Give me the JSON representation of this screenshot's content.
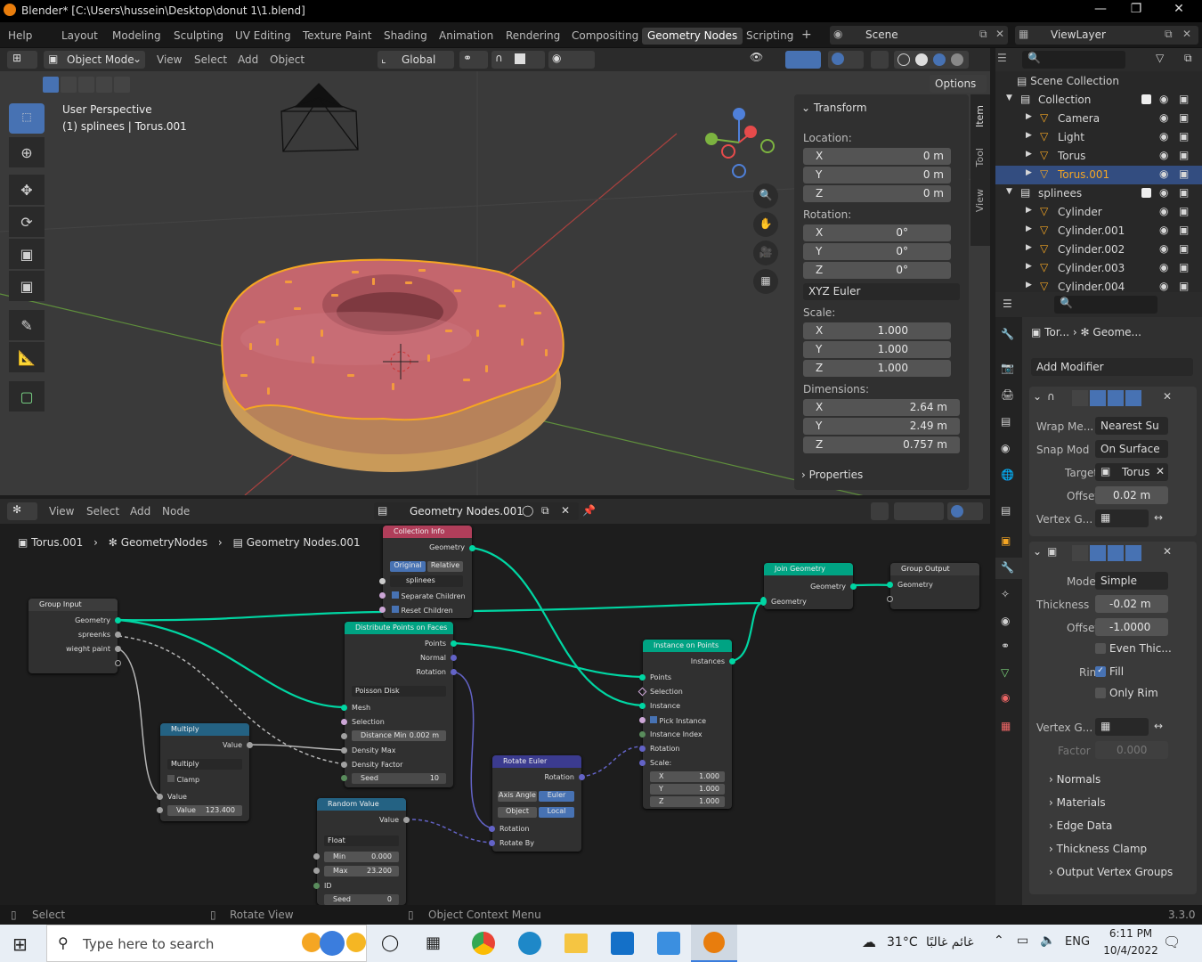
{
  "title": "Blender* [C:\\Users\\hussein\\Desktop\\donut 1\\1.blend]",
  "menu": {
    "help": "Help",
    "tabs": [
      "Layout",
      "Modeling",
      "Sculpting",
      "UV Editing",
      "Texture Paint",
      "Shading",
      "Animation",
      "Rendering",
      "Compositing",
      "Geometry Nodes",
      "Scripting"
    ],
    "active": "Geometry Nodes",
    "scene": "Scene",
    "viewlayer": "ViewLayer"
  },
  "viewport_header": {
    "mode": "Object Mode",
    "items": [
      "View",
      "Select",
      "Add",
      "Object"
    ],
    "orientation": "Global",
    "options": "Options"
  },
  "viewport": {
    "perspective": "User Perspective",
    "object": "(1) splinees | Torus.001"
  },
  "npanel": {
    "tabs": [
      "Item",
      "Tool",
      "View"
    ],
    "transform": "Transform",
    "location": "Location:",
    "loc": [
      "0 m",
      "0 m",
      "0 m"
    ],
    "rotation": "Rotation:",
    "rot": [
      "0°",
      "0°",
      "0°"
    ],
    "euler": "XYZ Euler",
    "scale": "Scale:",
    "scl": [
      "1.000",
      "1.000",
      "1.000"
    ],
    "dimensions": "Dimensions:",
    "dim": [
      "2.64 m",
      "2.49 m",
      "0.757 m"
    ],
    "axes": [
      "X",
      "Y",
      "Z"
    ],
    "properties": "Properties"
  },
  "outliner": {
    "title": "Scene Collection",
    "rows": [
      {
        "name": "Collection",
        "indent": 0
      },
      {
        "name": "Camera",
        "indent": 1
      },
      {
        "name": "Light",
        "indent": 1
      },
      {
        "name": "Torus",
        "indent": 1
      },
      {
        "name": "Torus.001",
        "indent": 1,
        "selected": true
      },
      {
        "name": "splinees",
        "indent": 0
      },
      {
        "name": "Cylinder",
        "indent": 1
      },
      {
        "name": "Cylinder.001",
        "indent": 1
      },
      {
        "name": "Cylinder.002",
        "indent": 1
      },
      {
        "name": "Cylinder.003",
        "indent": 1
      },
      {
        "name": "Cylinder.004",
        "indent": 1
      }
    ]
  },
  "properties": {
    "breadcrumb_obj": "Tor...",
    "breadcrumb_mod": "Geome...",
    "add_modifier": "Add Modifier",
    "shrinkwrap": {
      "wrap_label": "Wrap Me...",
      "wrap_value": "Nearest Su",
      "snap_label": "Snap Mod",
      "snap_value": "On Surface",
      "target_label": "Target",
      "target_value": "Torus",
      "offset_label": "Offset",
      "offset_value": "0.02 m",
      "vgroup_label": "Vertex G..."
    },
    "solidify": {
      "mode_label": "Mode",
      "mode_value": "Simple",
      "thickness_label": "Thickness",
      "thickness_value": "-0.02 m",
      "offset_label": "Offset",
      "offset_value": "-1.0000",
      "even": "Even Thic...",
      "rim_label": "Rim",
      "fill": "Fill",
      "only_rim": "Only Rim",
      "vgroup_label": "Vertex G...",
      "factor_label": "Factor",
      "factor_value": "0.000",
      "sections": [
        "Normals",
        "Materials",
        "Edge Data",
        "Thickness Clamp",
        "Output Vertex Groups"
      ]
    }
  },
  "node_header": {
    "items": [
      "View",
      "Select",
      "Add",
      "Node"
    ],
    "tree": "Geometry Nodes.001",
    "breadcrumb": [
      "Torus.001",
      "GeometryNodes",
      "Geometry Nodes.001"
    ]
  },
  "nodes": {
    "group_input": {
      "title": "Group Input",
      "outs": [
        "Geometry",
        "spreenks",
        "wieght paint"
      ]
    },
    "collection_info": {
      "title": "Collection Info",
      "out": "Geometry",
      "opt1": "Original",
      "opt2": "Relative",
      "coll": "splinees",
      "sep": "Separate Children",
      "reset": "Reset Children"
    },
    "distribute": {
      "title": "Distribute Points on Faces",
      "outs": [
        "Points",
        "Normal",
        "Rotation"
      ],
      "method": "Poisson Disk",
      "ins": [
        "Mesh",
        "Selection"
      ],
      "dist_label": "Distance Min",
      "dist_value": "0.002 m",
      "dmax": "Density Max",
      "dfac": "Density Factor",
      "seed_label": "Seed",
      "seed_value": "10"
    },
    "instance": {
      "title": "Instance on Points",
      "out": "Instances",
      "ins": [
        "Points",
        "Selection",
        "Instance"
      ],
      "pick": "Pick Instance",
      "idx": "Instance Index",
      "rot": "Rotation",
      "scale": "Scale:",
      "sx": "1.000",
      "sy": "1.000",
      "sz": "1.000"
    },
    "join": {
      "title": "Join Geometry",
      "out": "Geometry",
      "in": "Geometry"
    },
    "group_output": {
      "title": "Group Output",
      "in": "Geometry"
    },
    "multiply": {
      "title": "Multiply",
      "out": "Value",
      "op": "Multiply",
      "clamp": "Clamp",
      "in": "Value",
      "val_label": "Value",
      "val_value": "123.400"
    },
    "random": {
      "title": "Random Value",
      "out": "Value",
      "type": "Float",
      "min_label": "Min",
      "min_value": "0.000",
      "max_label": "Max",
      "max_value": "23.200",
      "id": "ID",
      "seed_label": "Seed",
      "seed_value": "0"
    },
    "rotate": {
      "title": "Rotate Euler",
      "out": "Rotation",
      "axis": "Axis Angle",
      "euler": "Euler",
      "object": "Object",
      "local": "Local",
      "in1": "Rotation",
      "in2": "Rotate By"
    }
  },
  "statusbar": {
    "select": "Select",
    "rotate": "Rotate View",
    "context": "Object Context Menu",
    "version": "3.3.0"
  },
  "taskbar": {
    "search": "Type here to search",
    "weather": "31°C",
    "weather_text": "غائم غالبًا",
    "lang": "ENG",
    "time": "6:11 PM",
    "date": "10/4/2022"
  },
  "colors": {
    "accent": "#4772b3",
    "geometry_socket": "#00d6a3",
    "selection_orange": "#f5a623"
  }
}
